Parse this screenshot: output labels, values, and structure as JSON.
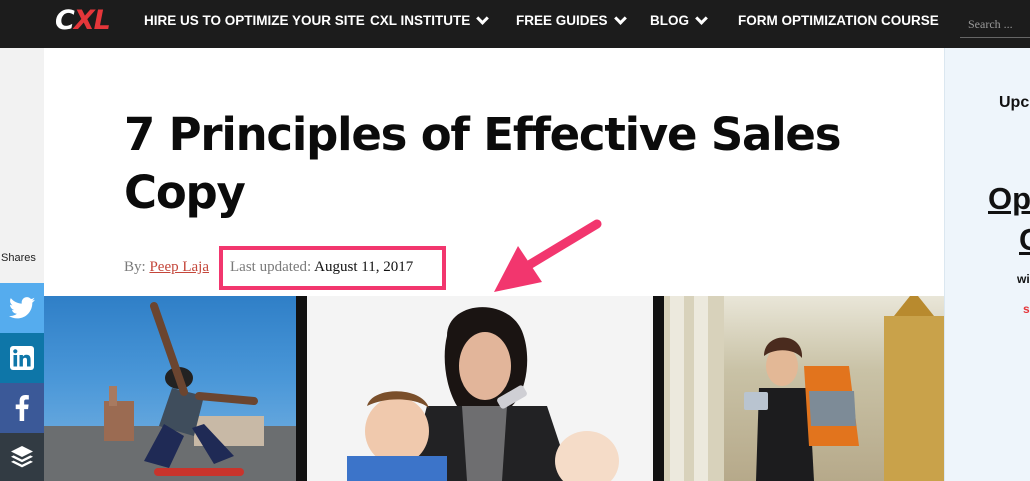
{
  "logo": {
    "c": "C",
    "xl": "XL"
  },
  "nav": {
    "items": [
      {
        "label": "HIRE US TO OPTIMIZE YOUR SITE",
        "has_dropdown": false
      },
      {
        "label": "CXL INSTITUTE",
        "has_dropdown": true
      },
      {
        "label": "FREE GUIDES",
        "has_dropdown": true
      },
      {
        "label": "BLOG",
        "has_dropdown": true
      },
      {
        "label": "FORM OPTIMIZATION COURSE",
        "has_dropdown": false
      }
    ],
    "search_placeholder": "Search ..."
  },
  "share": {
    "label": "Shares",
    "buttons": [
      {
        "network": "twitter",
        "icon": "twitter-icon",
        "color": "#55acee"
      },
      {
        "network": "linkedin",
        "icon": "linkedin-icon",
        "color": "#0e76a8"
      },
      {
        "network": "facebook",
        "icon": "facebook-icon",
        "color": "#3b5998"
      },
      {
        "network": "buffer",
        "icon": "buffer-icon",
        "color": "#323b43"
      }
    ]
  },
  "article": {
    "title": "7 Principles of Effective Sales Copy",
    "by_label": "By:",
    "author": "Peep Laja",
    "updated_label": "Last updated:",
    "updated_date": "August 11, 2017"
  },
  "annotation": {
    "highlight_color": "#f2366e"
  },
  "sidebar": {
    "heading_fragment": "Upc",
    "title_line1": "Op",
    "title_line2": "C",
    "sub_fragment": "wi",
    "link_fragment": "s"
  },
  "colors": {
    "accent": "#e5363a",
    "nav_bg": "#1c1c1c"
  }
}
